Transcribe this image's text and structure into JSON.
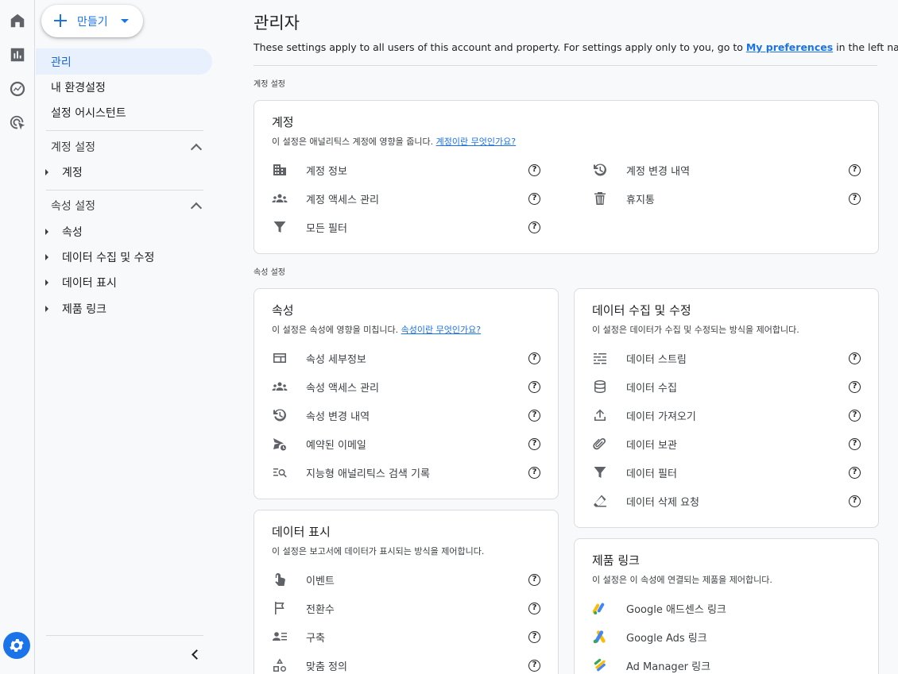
{
  "create": {
    "label": "만들기"
  },
  "nav": {
    "items": [
      {
        "label": "관리"
      },
      {
        "label": "내 환경설정"
      },
      {
        "label": "설정 어시스턴트"
      }
    ],
    "account_section": {
      "title": "계정 설정",
      "items": [
        {
          "label": "계정"
        }
      ]
    },
    "property_section": {
      "title": "속성 설정",
      "items": [
        {
          "label": "속성"
        },
        {
          "label": "데이터 수집 및 수정"
        },
        {
          "label": "데이터 표시"
        },
        {
          "label": "제품 링크"
        }
      ]
    }
  },
  "main": {
    "title": "관리자",
    "desc_prefix": "These settings apply to all users of this account and property. For settings apply only to you, go to ",
    "desc_link": "My preferences",
    "desc_suffix": " in the left navigation.",
    "account_label": "계정 설정",
    "property_label": "속성 설정"
  },
  "account_card": {
    "title": "계정",
    "desc": "이 설정은 애널리틱스 계정에 영향을 줍니다. ",
    "link": "계정이란 무엇인가요?",
    "items": [
      {
        "label": "계정 정보",
        "icon": "building-icon"
      },
      {
        "label": "계정 변경 내역",
        "icon": "history-icon"
      },
      {
        "label": "계정 액세스 관리",
        "icon": "group-icon"
      },
      {
        "label": "휴지통",
        "icon": "trash-icon"
      },
      {
        "label": "모든 필터",
        "icon": "filter-icon"
      }
    ]
  },
  "property_card": {
    "title": "속성",
    "desc": "이 설정은 속성에 영향을 미칩니다. ",
    "link": "속성이란 무엇인가요?",
    "items": [
      {
        "label": "속성 세부정보",
        "icon": "property-icon"
      },
      {
        "label": "속성 액세스 관리",
        "icon": "group-icon"
      },
      {
        "label": "속성 변경 내역",
        "icon": "history-icon"
      },
      {
        "label": "예약된 이메일",
        "icon": "scheduled-email-icon"
      },
      {
        "label": "지능형 애널리틱스 검색 기록",
        "icon": "search-history-icon"
      }
    ]
  },
  "data_collection_card": {
    "title": "데이터 수집 및 수정",
    "desc": "이 설정은 데이터가 수집 및 수정되는 방식을 제어합니다.",
    "items": [
      {
        "label": "데이터 스트림",
        "icon": "stream-icon"
      },
      {
        "label": "데이터 수집",
        "icon": "database-icon"
      },
      {
        "label": "데이터 가져오기",
        "icon": "upload-icon"
      },
      {
        "label": "데이터 보관",
        "icon": "attachment-icon"
      },
      {
        "label": "데이터 필터",
        "icon": "filter-icon"
      },
      {
        "label": "데이터 삭제 요청",
        "icon": "eraser-icon"
      }
    ]
  },
  "data_display_card": {
    "title": "데이터 표시",
    "desc": "이 설정은 보고서에 데이터가 표시되는 방식을 제어합니다.",
    "items": [
      {
        "label": "이벤트",
        "icon": "touch-icon"
      },
      {
        "label": "전환수",
        "icon": "flag-icon"
      },
      {
        "label": "구축",
        "icon": "audience-icon"
      },
      {
        "label": "맞춤 정의",
        "icon": "shapes-icon"
      }
    ]
  },
  "product_links_card": {
    "title": "제품 링크",
    "desc": "이 설정은 이 속성에 연결되는 제품을 제어합니다.",
    "items": [
      {
        "label": "Google 애드센스 링크",
        "icon": "adsense-icon"
      },
      {
        "label": "Google Ads 링크",
        "icon": "google-ads-icon"
      },
      {
        "label": "Ad Manager 링크",
        "icon": "ad-manager-icon"
      }
    ]
  },
  "help_glyph": "?",
  "colors": {
    "accent": "#1a73e8",
    "active_bg": "#e8f0fe",
    "border": "#dadce0"
  }
}
